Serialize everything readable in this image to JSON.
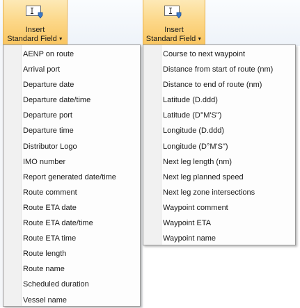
{
  "ribbon": {
    "button_1": {
      "line1": "Insert",
      "line2": "Standard Field",
      "icon": "text-field-icon"
    },
    "button_2": {
      "line1": "Insert",
      "line2": "Standard Field",
      "icon": "text-field-icon"
    }
  },
  "menu_1": {
    "items": [
      "AENP on route",
      "Arrival port",
      "Departure date",
      "Departure date/time",
      "Departure port",
      "Departure time",
      "Distributor Logo",
      "IMO number",
      "Report generated date/time",
      "Route comment",
      "Route ETA date",
      "Route ETA date/time",
      "Route ETA time",
      "Route length",
      "Route name",
      "Scheduled duration",
      "Vessel name"
    ]
  },
  "menu_2": {
    "items": [
      "Course to next waypoint",
      "Distance from start of route (nm)",
      "Distance to end of route (nm)",
      "Latitude (D.ddd)",
      "Latitude (D°M'S\")",
      "Longitude (D.ddd)",
      "Longitude (D°M'S\")",
      "Next leg length (nm)",
      "Next leg planned speed",
      "Next leg zone intersections",
      "Waypoint comment",
      "Waypoint ETA",
      "Waypoint name"
    ]
  },
  "colors": {
    "button_highlight": "#fcd88a",
    "menu_border": "#9a9a9a",
    "gutter": "#f1f1f1"
  }
}
